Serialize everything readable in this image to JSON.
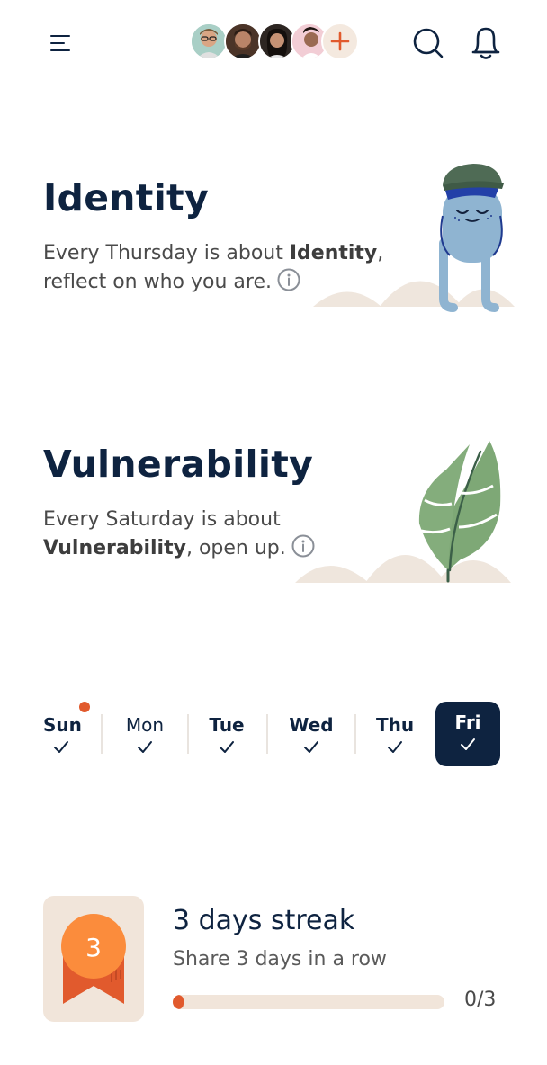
{
  "header": {
    "menu_icon": "menu-icon",
    "members": [
      "member-1",
      "member-2",
      "member-3",
      "member-4"
    ],
    "add_member_label": "+",
    "search_icon": "search-icon",
    "bell_icon": "bell-icon"
  },
  "topics": [
    {
      "title": "Identity",
      "desc_prefix": "Every Thursday is about ",
      "desc_bold": "Identity",
      "desc_suffix": ",",
      "desc_line2": "reflect on who you are.",
      "illustration": "character-illustration"
    },
    {
      "title": "Vulnerability",
      "desc_line1": "Every Saturday is about",
      "desc_bold": "Vulnerability",
      "desc_suffix": ", open up.",
      "illustration": "leaf-illustration"
    }
  ],
  "week": {
    "days": [
      {
        "label": "Sun",
        "checked": true,
        "dot": true
      },
      {
        "label": "Mon",
        "checked": true
      },
      {
        "label": "Tue",
        "checked": true
      },
      {
        "label": "Wed",
        "checked": true
      },
      {
        "label": "Thu",
        "checked": true
      },
      {
        "label": "Fri",
        "checked": true,
        "active": true
      }
    ],
    "accent": "#e15a2d",
    "active_bg": "#0e2340"
  },
  "streak": {
    "badge_number": "3",
    "title": "3 days streak",
    "subtitle": "Share 3 days in a row",
    "progress": 0.04,
    "count": "0/3"
  }
}
